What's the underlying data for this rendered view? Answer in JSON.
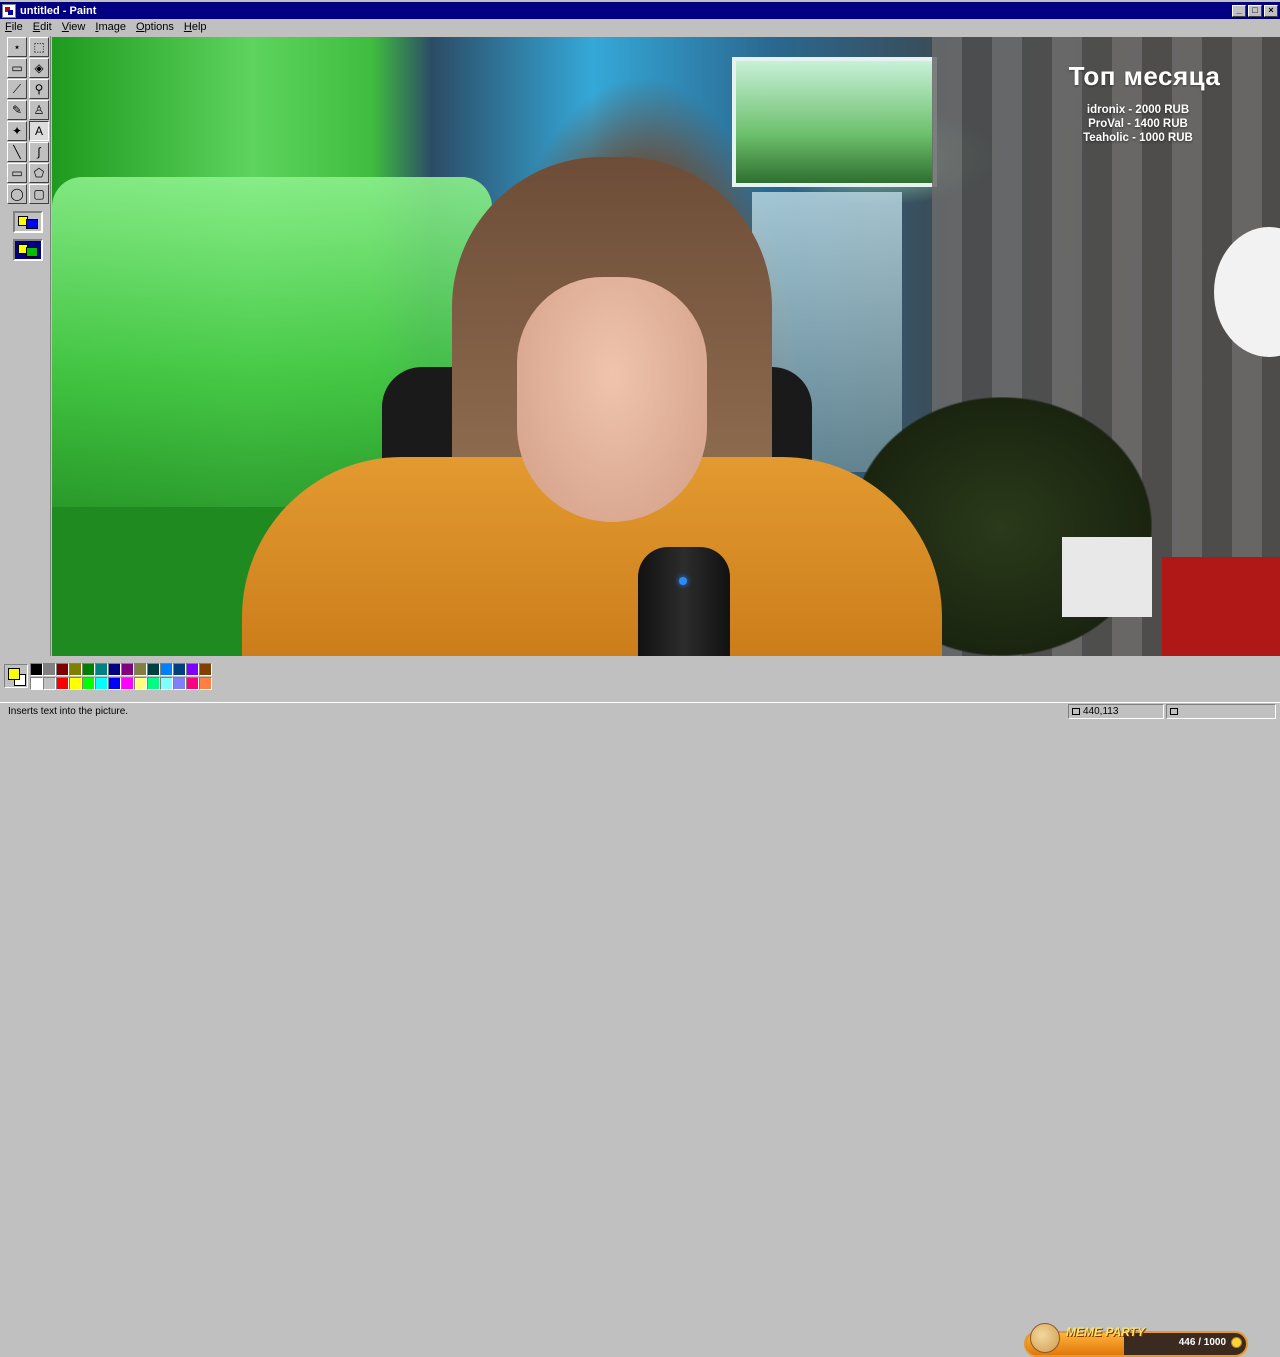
{
  "window": {
    "title": "untitled - Paint",
    "minimize_glyph": "_",
    "maximize_glyph": "□",
    "close_glyph": "×"
  },
  "menu": [
    {
      "label_u": "F",
      "label_rest": "ile"
    },
    {
      "label_u": "E",
      "label_rest": "dit"
    },
    {
      "label_u": "V",
      "label_rest": "iew"
    },
    {
      "label_u": "I",
      "label_rest": "mage"
    },
    {
      "label_u": "O",
      "label_rest": "ptions"
    },
    {
      "label_u": "H",
      "label_rest": "elp"
    }
  ],
  "tools": [
    {
      "name": "free-select-icon",
      "glyph": "⋆"
    },
    {
      "name": "rect-select-icon",
      "glyph": "⬚"
    },
    {
      "name": "eraser-icon",
      "glyph": "▭"
    },
    {
      "name": "fill-icon",
      "glyph": "◈"
    },
    {
      "name": "pick-color-icon",
      "glyph": "⟋"
    },
    {
      "name": "magnifier-icon",
      "glyph": "⚲"
    },
    {
      "name": "pencil-icon",
      "glyph": "✎"
    },
    {
      "name": "brush-icon",
      "glyph": "♙"
    },
    {
      "name": "airbrush-icon",
      "glyph": "✦"
    },
    {
      "name": "text-icon",
      "glyph": "A"
    },
    {
      "name": "line-icon",
      "glyph": "╲"
    },
    {
      "name": "curve-icon",
      "glyph": "∫"
    },
    {
      "name": "rectangle-icon",
      "glyph": "▭"
    },
    {
      "name": "polygon-icon",
      "glyph": "⬠"
    },
    {
      "name": "ellipse-icon",
      "glyph": "◯"
    },
    {
      "name": "rounded-rectangle-icon",
      "glyph": "▢"
    }
  ],
  "selected_tool": "text-icon",
  "overlay": {
    "title": "Топ месяца",
    "donors": [
      "idronix - 2000 RUB",
      "ProVal - 1400 RUB",
      "Teaholic - 1000 RUB"
    ]
  },
  "palette": {
    "foreground": "#ffff00",
    "background": "#ffffff",
    "colors_top": [
      "#000000",
      "#808080",
      "#800000",
      "#808000",
      "#008000",
      "#008080",
      "#000080",
      "#800080",
      "#808040",
      "#004040",
      "#0080ff",
      "#004080",
      "#8000ff",
      "#804000"
    ],
    "colors_bottom": [
      "#ffffff",
      "#c0c0c0",
      "#ff0000",
      "#ffff00",
      "#00ff00",
      "#00ffff",
      "#0000ff",
      "#ff00ff",
      "#ffff80",
      "#00ff80",
      "#80ffff",
      "#8080ff",
      "#ff0080",
      "#ff8040"
    ]
  },
  "widget": {
    "label": "MEME PARTY",
    "count": "446 / 1000",
    "progress": 0.446
  },
  "status": {
    "text": "Inserts text into the picture.",
    "coords": "440,113",
    "size": ""
  }
}
